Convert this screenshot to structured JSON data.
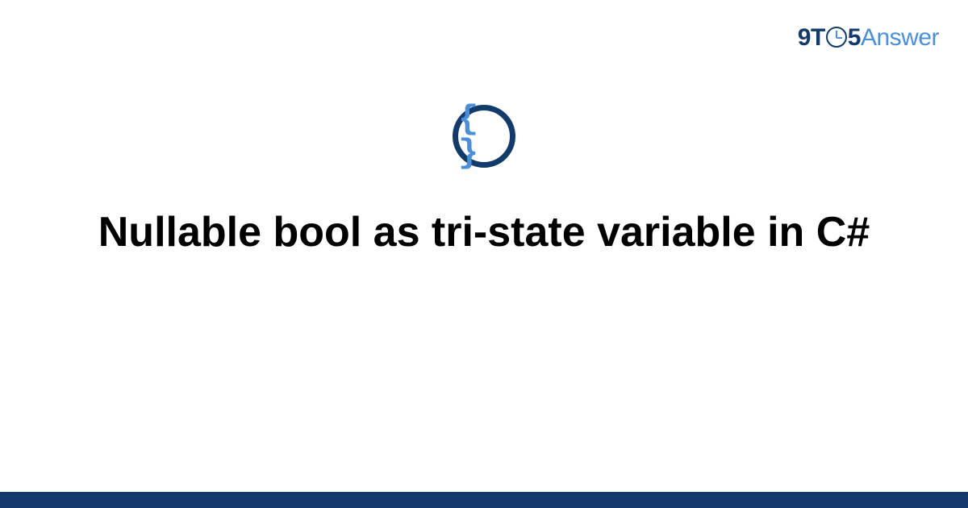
{
  "logo": {
    "nine": "9",
    "t": "T",
    "five": "5",
    "answer": "Answer"
  },
  "icon": {
    "braces": "{ }",
    "name": "code-braces-icon"
  },
  "title": "Nullable bool as tri-state variable in C#",
  "colors": {
    "dark_blue": "#123a6b",
    "light_blue": "#4a8fd8",
    "text": "#000000"
  }
}
